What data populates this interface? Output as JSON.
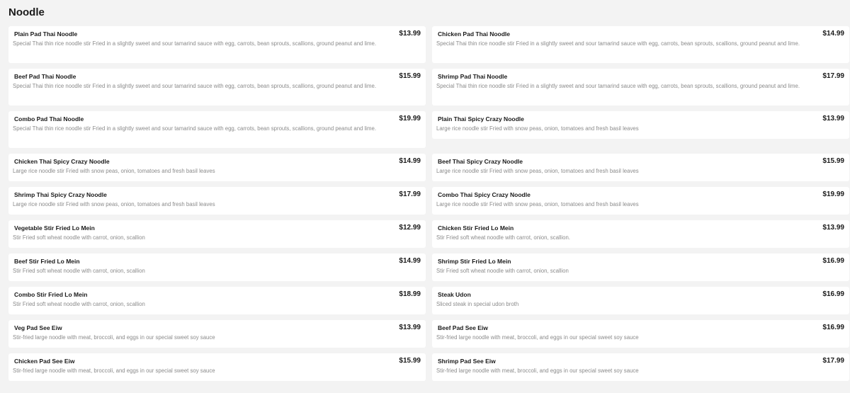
{
  "section": {
    "title": "Noodle"
  },
  "items": [
    {
      "name": "Plain Pad Thai Noodle",
      "price": "$13.99",
      "desc": "Special Thai thin rice noodle stir Fried in a slightly sweet and sour tamarind sauce with egg, carrots, bean sprouts, scallions, ground peanut and lime."
    },
    {
      "name": "Chicken Pad Thai Noodle",
      "price": "$14.99",
      "desc": "Special Thai thin rice noodle stir Fried in a slightly sweet and sour tamarind sauce with egg, carrots, bean sprouts, scallions, ground peanut and lime."
    },
    {
      "name": "Beef Pad Thai Noodle",
      "price": "$15.99",
      "desc": "Special Thai thin rice noodle stir Fried in a slightly sweet and sour tamarind sauce with egg, carrots, bean sprouts, scallions, ground peanut and lime."
    },
    {
      "name": "Shrimp Pad Thai Noodle",
      "price": "$17.99",
      "desc": "Special Thai thin rice noodle stir Fried in a slightly sweet and sour tamarind sauce with egg, carrots, bean sprouts, scallions, ground peanut and lime."
    },
    {
      "name": "Combo Pad Thai Noodle",
      "price": "$19.99",
      "desc": "Special Thai thin rice noodle stir Fried in a slightly sweet and sour tamarind sauce with egg, carrots, bean sprouts, scallions, ground peanut and lime."
    },
    {
      "name": "Plain Thai Spicy Crazy Noodle",
      "price": "$13.99",
      "desc": "Large rice noodle stir Fried with snow peas, onion, tomatoes and fresh basil leaves"
    },
    {
      "name": "Chicken Thai Spicy Crazy Noodle",
      "price": "$14.99",
      "desc": "Large rice noodle stir Fried with snow peas, onion, tomatoes and fresh basil leaves"
    },
    {
      "name": "Beef Thai Spicy Crazy Noodle",
      "price": "$15.99",
      "desc": "Large rice noodle stir Fried with snow peas, onion, tomatoes and fresh basil leaves"
    },
    {
      "name": "Shrimp Thai Spicy Crazy Noodle",
      "price": "$17.99",
      "desc": "Large rice noodle stir Fried with snow peas, onion, tomatoes and fresh basil leaves"
    },
    {
      "name": "Combo Thai Spicy Crazy Noodle",
      "price": "$19.99",
      "desc": "Large rice noodle stir Fried with snow peas, onion, tomatoes and fresh basil leaves"
    },
    {
      "name": "Vegetable Stir Fried Lo Mein",
      "price": "$12.99",
      "desc": "Stir Fried soft wheat noodle with carrot, onion, scallion"
    },
    {
      "name": "Chicken Stir Fried Lo Mein",
      "price": "$13.99",
      "desc": "Stir Fried soft wheat noodle with carrot, onion, scallion."
    },
    {
      "name": "Beef Stir Fried Lo Mein",
      "price": "$14.99",
      "desc": "Stir Fried soft wheat noodle with carrot, onion, scallion"
    },
    {
      "name": "Shrimp Stir Fried Lo Mein",
      "price": "$16.99",
      "desc": "Stir Fried soft wheat noodle with carrot, onion, scallion"
    },
    {
      "name": "Combo Stir Fried Lo Mein",
      "price": "$18.99",
      "desc": "Stir Fried soft wheat noodle with carrot, onion, scallion"
    },
    {
      "name": "Steak Udon",
      "price": "$16.99",
      "desc": "Sliced steak in special udon broth"
    },
    {
      "name": "Veg Pad See Eiw",
      "price": "$13.99",
      "desc": "Stir-fried large noodle with meat, broccoli, and eggs in our special sweet soy sauce"
    },
    {
      "name": "Beef Pad See Eiw",
      "price": "$16.99",
      "desc": "Stir-fried large noodle with meat, broccoli, and eggs in our special sweet soy sauce"
    },
    {
      "name": "Chicken Pad See Eiw",
      "price": "$15.99",
      "desc": "Stir-fried large noodle with meat, broccoli, and eggs in our special sweet soy sauce"
    },
    {
      "name": "Shrimp Pad See Eiw",
      "price": "$17.99",
      "desc": "Stir-fried large noodle with meat, broccoli, and eggs in our special sweet soy sauce"
    }
  ]
}
